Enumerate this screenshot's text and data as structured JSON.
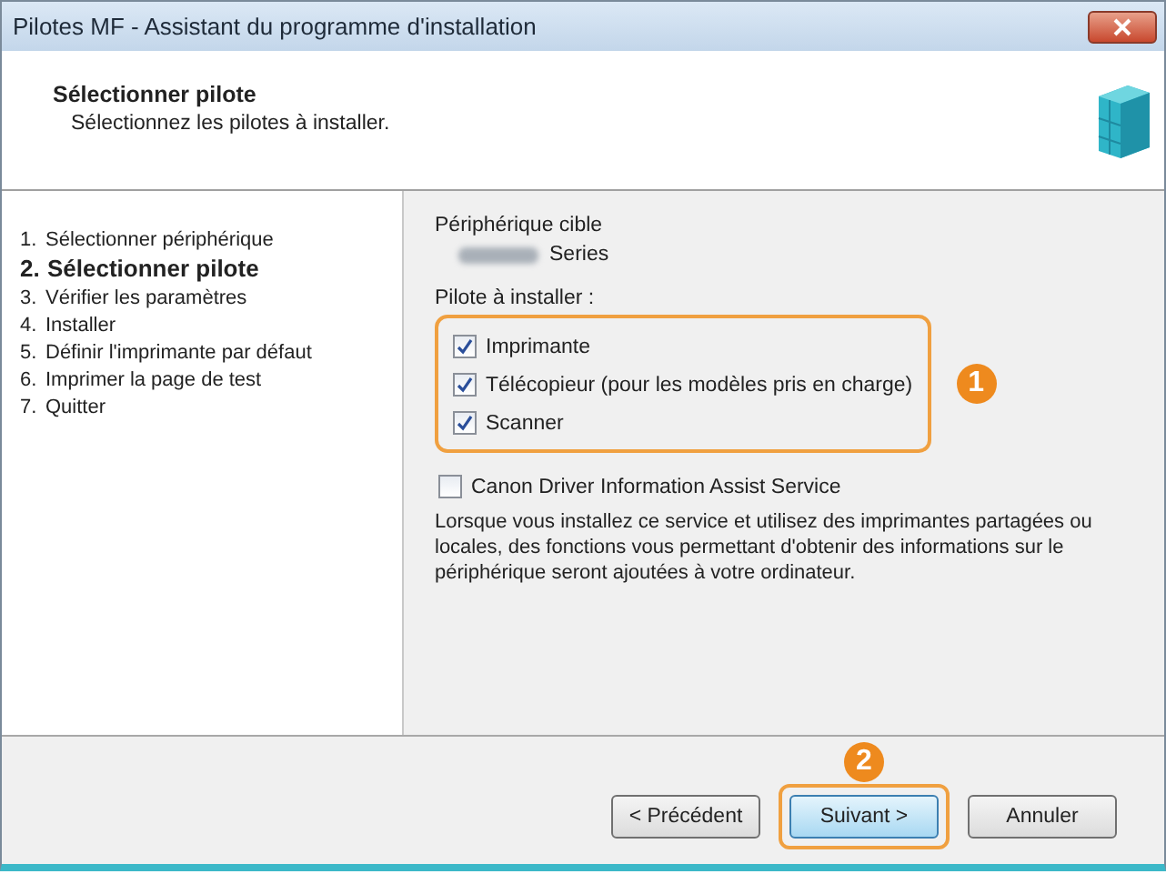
{
  "window": {
    "title": "Pilotes MF - Assistant du programme d'installation"
  },
  "header": {
    "title": "Sélectionner pilote",
    "subtitle": "Sélectionnez les pilotes à installer."
  },
  "steps": [
    {
      "number": "1.",
      "label": "Sélectionner périphérique",
      "selected": false
    },
    {
      "number": "2.",
      "label": "Sélectionner pilote",
      "selected": true
    },
    {
      "number": "3.",
      "label": "Vérifier les paramètres",
      "selected": false
    },
    {
      "number": "4.",
      "label": "Installer",
      "selected": false
    },
    {
      "number": "5.",
      "label": "Définir l'imprimante par défaut",
      "selected": false
    },
    {
      "number": "6.",
      "label": "Imprimer la page de test",
      "selected": false
    },
    {
      "number": "7.",
      "label": "Quitter",
      "selected": false
    }
  ],
  "target_device": {
    "label": "Périphérique cible",
    "device": "Series"
  },
  "drivers": {
    "label": "Pilote à installer :",
    "badge": "1",
    "items": [
      {
        "label": "Imprimante",
        "checked": true
      },
      {
        "label": "Télécopieur (pour les modèles pris en charge)",
        "checked": true
      },
      {
        "label": "Scanner",
        "checked": true
      }
    ]
  },
  "service": {
    "label": "Canon Driver Information Assist Service",
    "checked": false,
    "description": "Lorsque vous installez ce service et utilisez des imprimantes partagées ou locales, des fonctions vous permettant d'obtenir des informations sur le périphérique seront ajoutées à votre ordinateur."
  },
  "buttons": [
    {
      "label": "< Précédent",
      "highlighted": false
    },
    {
      "label": "Suivant >",
      "highlighted": true,
      "badge": "2"
    },
    {
      "label": "Annuler",
      "highlighted": false
    }
  ]
}
